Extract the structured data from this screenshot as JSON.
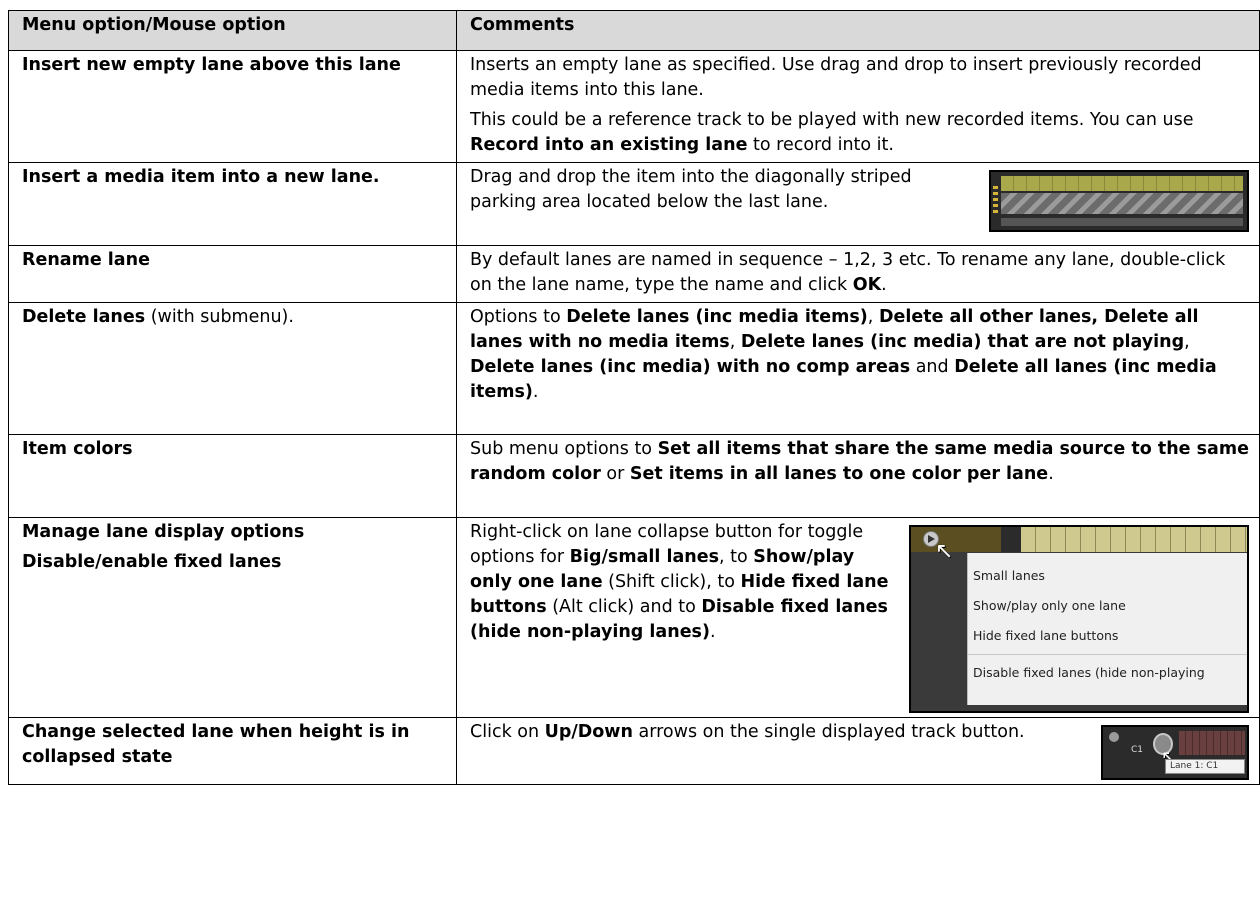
{
  "header": {
    "col1": "Menu option/Mouse option",
    "col2": "Comments"
  },
  "rows": [
    {
      "option": "Insert new empty lane above this lane",
      "c1": "Inserts an empty lane as specified. Use drag and drop to insert previously recorded media items into this lane.",
      "c2a": "This could be a reference track to be played with new recorded items. You can use ",
      "c2b": "Record into an existing lane",
      "c2c": " to record into it."
    },
    {
      "option": "Insert a media item into a new lane.",
      "c1": "Drag and drop the item into the diagonally striped parking area located below the last lane."
    },
    {
      "option": "Rename lane",
      "c1a": "By default lanes are named in sequence – 1,2, 3 etc. To rename any lane, double-click on the lane name, type the name and click ",
      "c1b": "OK",
      "c1c": "."
    },
    {
      "option_bold": "Delete lanes",
      "option_rest": " (with submenu).",
      "s1": "Options to ",
      "b1": "Delete lanes (inc media items)",
      "s2": ", ",
      "b2": "Delete all other lanes, Delete all lanes with no media items",
      "s3": ", ",
      "b3": "Delete lanes (inc media) that are not playing",
      "s4": ", ",
      "b4": "Delete lanes (inc media) with no comp areas",
      "s5": " and ",
      "b5": "Delete all lanes (inc media items)",
      "s6": "."
    },
    {
      "option": "Item colors",
      "s1": "Sub menu options to ",
      "b1": "Set all items that share the same media source to the same random color",
      "s2": " or ",
      "b2": "Set items in all lanes to one color per lane",
      "s3": "."
    },
    {
      "option1": "Manage lane display options",
      "option2": "Disable/enable fixed lanes",
      "s1": "Right-click on lane collapse button for toggle options for ",
      "b1": "Big/small lanes",
      "s2": ", to ",
      "b2": "Show/play only one lane",
      "s3": " (Shift click), to ",
      "b3": "Hide fixed lane buttons",
      "s4": " (Alt click) and to ",
      "b4": "Disable fixed lanes (hide non-playing lanes)",
      "s5": ".",
      "menu": {
        "items": [
          "Small lanes",
          "Show/play only one lane",
          "Hide fixed lane buttons"
        ],
        "last": "Disable fixed lanes (hide non-playing"
      }
    },
    {
      "option": "Change selected lane when height is in collapsed state",
      "s1": "Click on ",
      "b1": "Up/Down",
      "s2": " arrows on the single displayed track button.",
      "lane_label": "C1",
      "tooltip": "Lane 1: C1"
    }
  ]
}
